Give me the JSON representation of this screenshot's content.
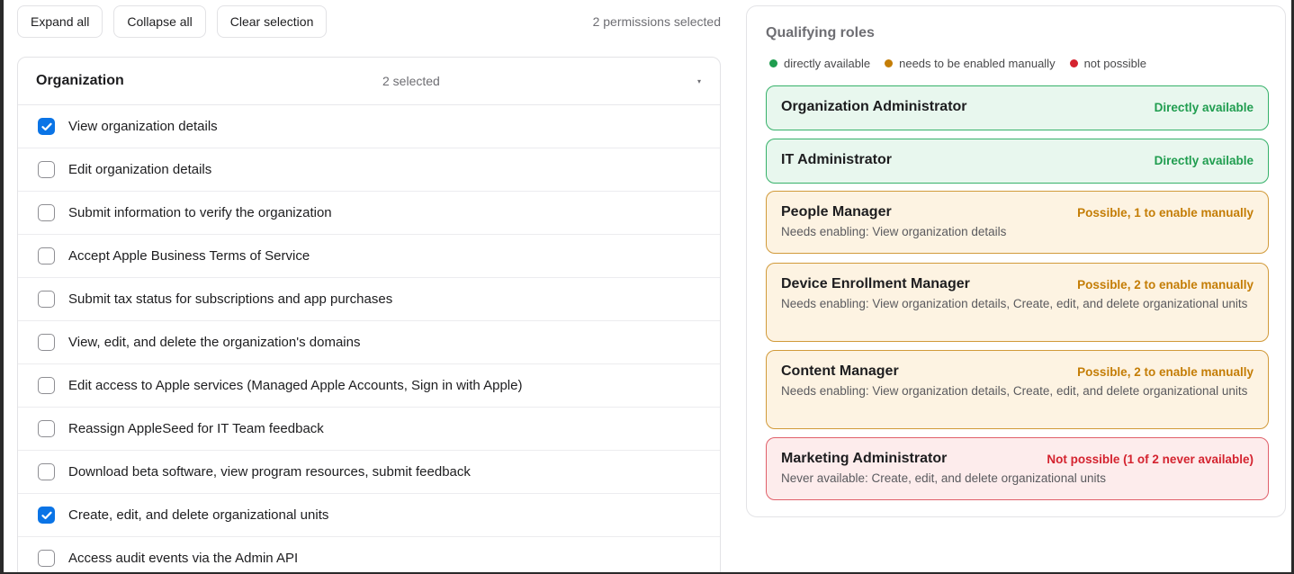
{
  "toolbar": {
    "expand_all": "Expand all",
    "collapse_all": "Collapse all",
    "clear_selection": "Clear selection",
    "selection_summary": "2 permissions selected"
  },
  "group": {
    "title": "Organization",
    "selected_count": "2 selected",
    "caret": "▾",
    "permissions": [
      {
        "label": "View organization details",
        "checked": true
      },
      {
        "label": "Edit organization details",
        "checked": false
      },
      {
        "label": "Submit information to verify the organization",
        "checked": false
      },
      {
        "label": "Accept Apple Business Terms of Service",
        "checked": false
      },
      {
        "label": "Submit tax status for subscriptions and app purchases",
        "checked": false
      },
      {
        "label": "View, edit, and delete the organization's domains",
        "checked": false
      },
      {
        "label": "Edit access to Apple services (Managed Apple Accounts, Sign in with Apple)",
        "checked": false
      },
      {
        "label": "Reassign AppleSeed for IT Team feedback",
        "checked": false
      },
      {
        "label": "Download beta software, view program resources, submit feedback",
        "checked": false
      },
      {
        "label": "Create, edit, and delete organizational units",
        "checked": true
      },
      {
        "label": "Access audit events via the Admin API",
        "checked": false
      }
    ]
  },
  "qualifying": {
    "title": "Qualifying roles",
    "legend": [
      {
        "label": "directly available",
        "color": "#1f9d4f"
      },
      {
        "label": "needs to be enabled manually",
        "color": "#c47d06"
      },
      {
        "label": "not possible",
        "color": "#d4232f"
      }
    ],
    "roles": [
      {
        "name": "Organization Administrator",
        "status": "Directly available",
        "kind": "green",
        "note": ""
      },
      {
        "name": "IT Administrator",
        "status": "Directly available",
        "kind": "green",
        "note": ""
      },
      {
        "name": "People Manager",
        "status": "Possible, 1 to enable manually",
        "kind": "orange",
        "note": "Needs enabling: View organization details"
      },
      {
        "name": "Device Enrollment Manager",
        "status": "Possible, 2 to enable manually",
        "kind": "orange",
        "note": "Needs enabling: View organization details, Create, edit, and delete organizational units"
      },
      {
        "name": "Content Manager",
        "status": "Possible, 2 to enable manually",
        "kind": "orange",
        "note": "Needs enabling: View organization details, Create, edit, and delete organizational units"
      },
      {
        "name": "Marketing Administrator",
        "status": "Not possible (1 of 2 never available)",
        "kind": "red",
        "note": "Never available: Create, edit, and delete organizational units"
      }
    ]
  }
}
